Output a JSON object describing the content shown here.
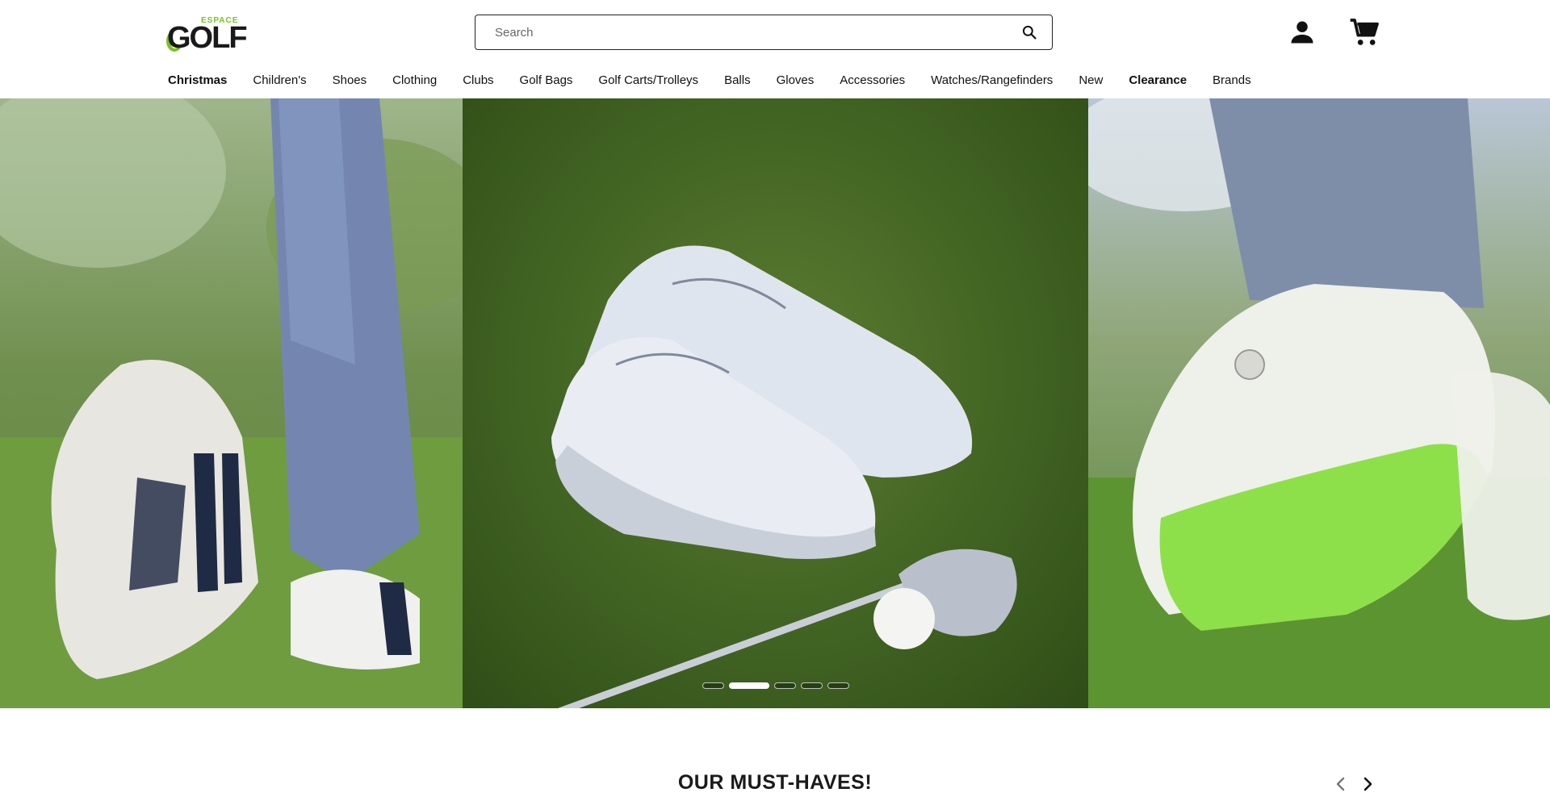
{
  "brand": {
    "logo_top": "ESPACE",
    "logo_main": "GOLF",
    "accent_color": "#7cc21f"
  },
  "search": {
    "placeholder": "Search",
    "value": "",
    "icon": "search-icon"
  },
  "header_icons": {
    "account": "account-icon",
    "cart": "cart-icon"
  },
  "nav": {
    "items": [
      {
        "label": "Christmas",
        "bold": true
      },
      {
        "label": "Children's",
        "bold": false
      },
      {
        "label": "Shoes",
        "bold": false
      },
      {
        "label": "Clothing",
        "bold": false
      },
      {
        "label": "Clubs",
        "bold": false
      },
      {
        "label": "Golf Bags",
        "bold": false
      },
      {
        "label": "Golf Carts/Trolleys",
        "bold": false
      },
      {
        "label": "Balls",
        "bold": false
      },
      {
        "label": "Gloves",
        "bold": false
      },
      {
        "label": "Accessories",
        "bold": false
      },
      {
        "label": "Watches/Rangefinders",
        "bold": false
      },
      {
        "label": "New",
        "bold": false
      },
      {
        "label": "Clearance",
        "bold": true
      },
      {
        "label": "Brands",
        "bold": false
      }
    ]
  },
  "hero": {
    "slides": [
      {
        "name": "golf-shoe-heel-image"
      },
      {
        "name": "white-sneakers-on-grass-image"
      },
      {
        "name": "green-sole-golf-shoe-image"
      }
    ],
    "pagination": {
      "count": 5,
      "active_index": 1
    }
  },
  "section": {
    "title": "OUR MUST-HAVES!",
    "prev_icon": "chevron-left-icon",
    "next_icon": "chevron-right-icon"
  }
}
